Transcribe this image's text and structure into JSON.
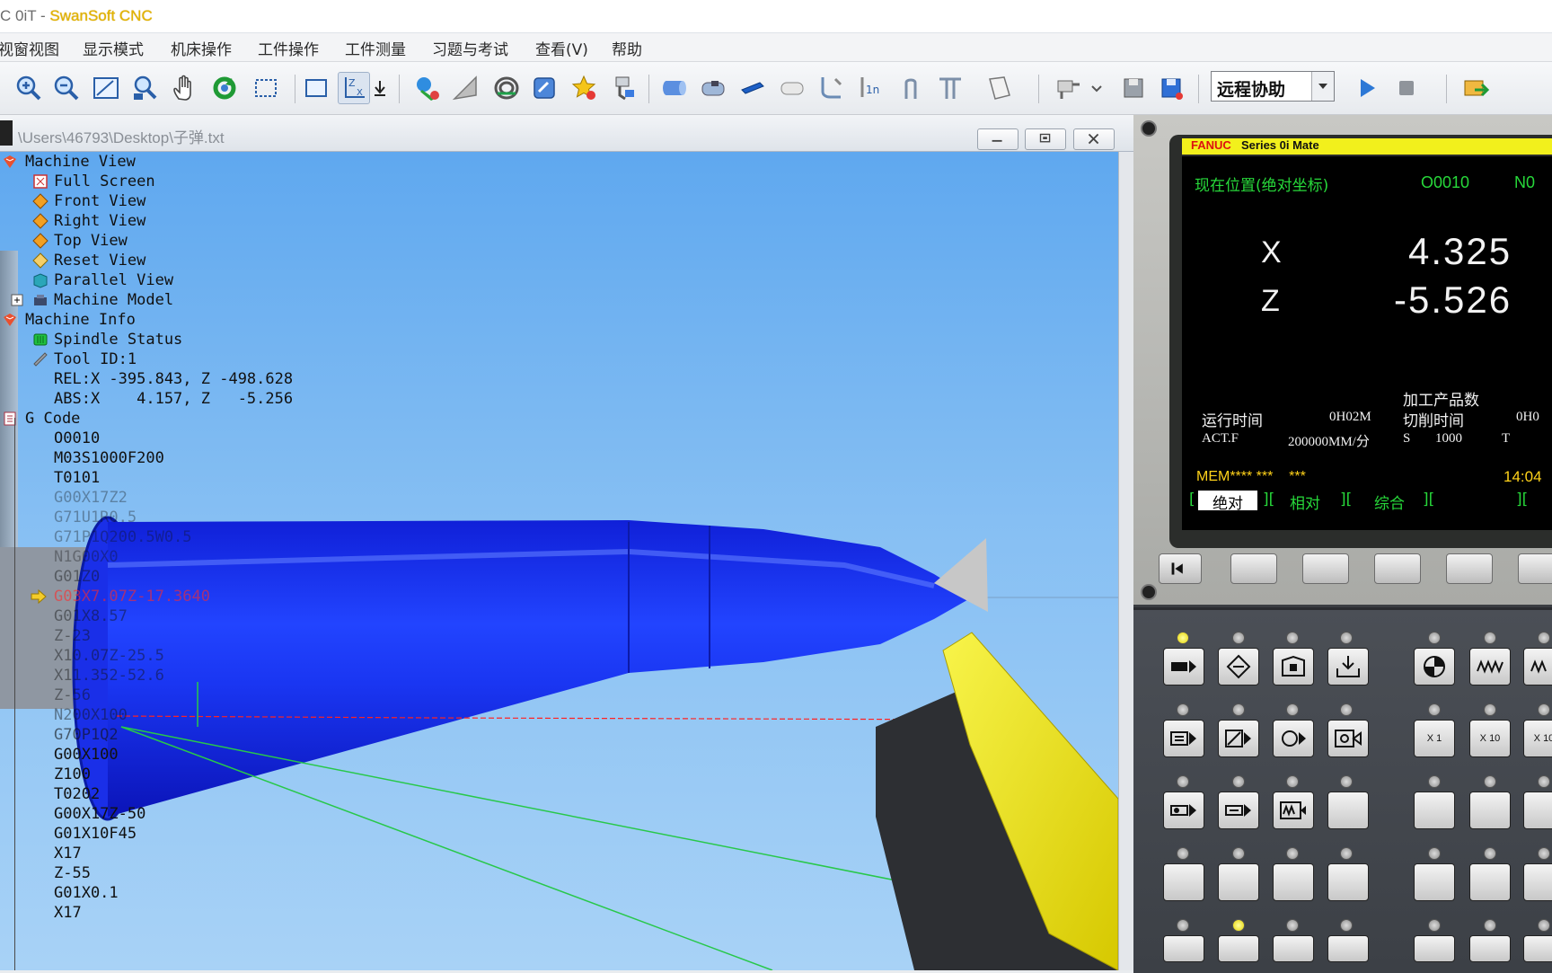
{
  "app": {
    "title_prefix": "C 0iT - ",
    "title_brand": "SwanSoft CNC"
  },
  "menu": [
    "视窗视图",
    "显示模式",
    "机床操作",
    "工件操作",
    "工件测量",
    "习题与考试",
    "查看(V)",
    "帮助"
  ],
  "toolbar": {
    "remote_help_value": "远程协助"
  },
  "child_window": {
    "path": "\\Users\\46793\\Desktop\\子弹.txt"
  },
  "tree": {
    "machine_view": "Machine View",
    "full_screen": "Full Screen",
    "front_view": "Front View",
    "right_view": "Right View",
    "top_view": "Top View",
    "reset_view": "Reset View",
    "parallel_view": "Parallel View",
    "machine_model": "Machine Model",
    "machine_info": "Machine Info",
    "spindle_status": "Spindle Status",
    "tool_id": "Tool ID:1",
    "rel": "REL:X -395.843, Z -498.628",
    "abs": "ABS:X    4.157, Z   -5.256",
    "g_code": "G Code",
    "gcode_lines": [
      "O0010",
      "M03S1000F200",
      "T0101",
      "G00X17Z2",
      "G71U1R0.5",
      "G71P1Q200.5W0.5",
      "N1G00X0",
      "G01Z0",
      "G03X7.07Z-17.3640",
      "G01X8.57",
      "Z-23",
      "X10.07Z-25.5",
      "X11.352-52.6",
      "Z-56",
      "N200X100",
      "G70P1Q2",
      "G00X100",
      "Z100",
      "T0202",
      "G00X17Z-50",
      "G01X10F45",
      "X17",
      "Z-55",
      "G01X0.1",
      "X17"
    ]
  },
  "cnc": {
    "brand": "FANUC",
    "series": "Series 0i Mate",
    "screen_title": "现在位置(绝对坐标)",
    "program": "O0010",
    "program_n": "N0",
    "x_label": "X",
    "x_value": "4.325",
    "z_label": "Z",
    "z_value": "-5.526",
    "parts_label": "加工产品数",
    "run_time_label": "运行时间",
    "run_time_value": "0H02M",
    "cut_time_label": "切削时间",
    "cut_time_value": "0H0",
    "actf_label": "ACT.F",
    "actf_value": "200000MM/分",
    "s_label": "S",
    "s_value": "1000",
    "t_label": "T",
    "mode": "MEM**** ***    ***",
    "clock": "14:04",
    "softkeys": [
      "绝对",
      "相对",
      "综合"
    ],
    "jog_labels": [
      "X  1",
      "X  10",
      "X 10"
    ]
  }
}
